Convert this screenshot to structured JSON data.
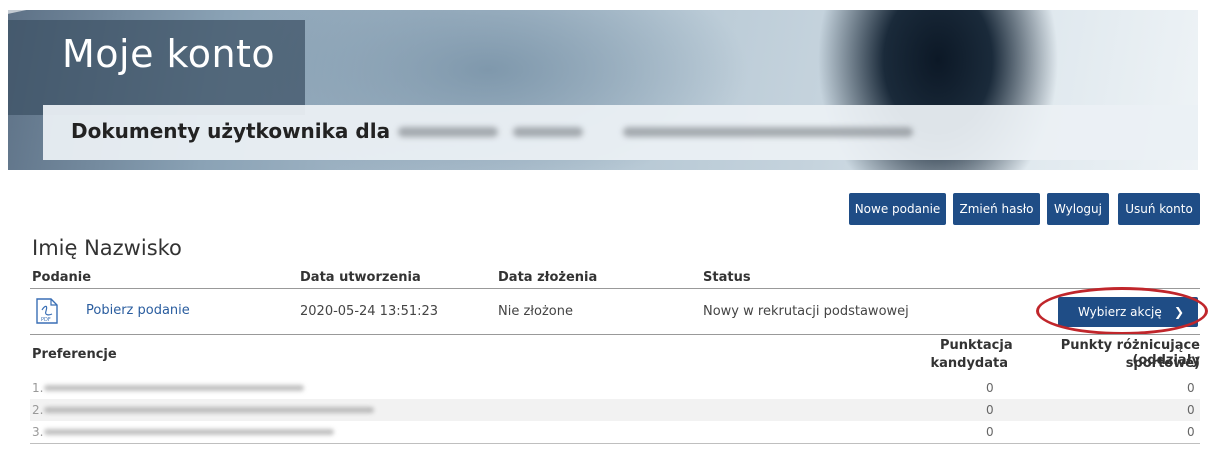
{
  "banner": {
    "title": "Moje konto",
    "subtitle": "Dokumenty użytkownika dla"
  },
  "toolbar": {
    "new_submission": "Nowe podanie",
    "change_password": "Zmień hasło",
    "logout": "Wyloguj",
    "delete_account": "Usuń konto"
  },
  "user": {
    "name": "Imię Nazwisko"
  },
  "table": {
    "headers": {
      "podanie": "Podanie",
      "created": "Data utworzenia",
      "submitted": "Data złożenia",
      "status": "Status"
    },
    "row": {
      "icon": "pdf-file-icon",
      "download_link": "Pobierz podanie",
      "created": "2020-05-24 13:51:23",
      "submitted": "Nie złożone",
      "status": "Nowy w rekrutacji podstawowej",
      "action_button": "Wybierz akcję"
    }
  },
  "preferences": {
    "header": "Preferencje",
    "col_score_line1": "Punktacja",
    "col_score_line2": "kandydata",
    "col_diff_line1": "Punkty różnicujące (oddziały",
    "col_diff_line2": "sportowe)",
    "rows": [
      {
        "num": "1.",
        "score": "0",
        "diff": "0"
      },
      {
        "num": "2.",
        "score": "0",
        "diff": "0"
      },
      {
        "num": "3.",
        "score": "0",
        "diff": "0"
      }
    ]
  },
  "colors": {
    "button_bg": "#1f4d86",
    "link": "#2a5d9f",
    "highlight_ellipse": "#c0262b"
  }
}
